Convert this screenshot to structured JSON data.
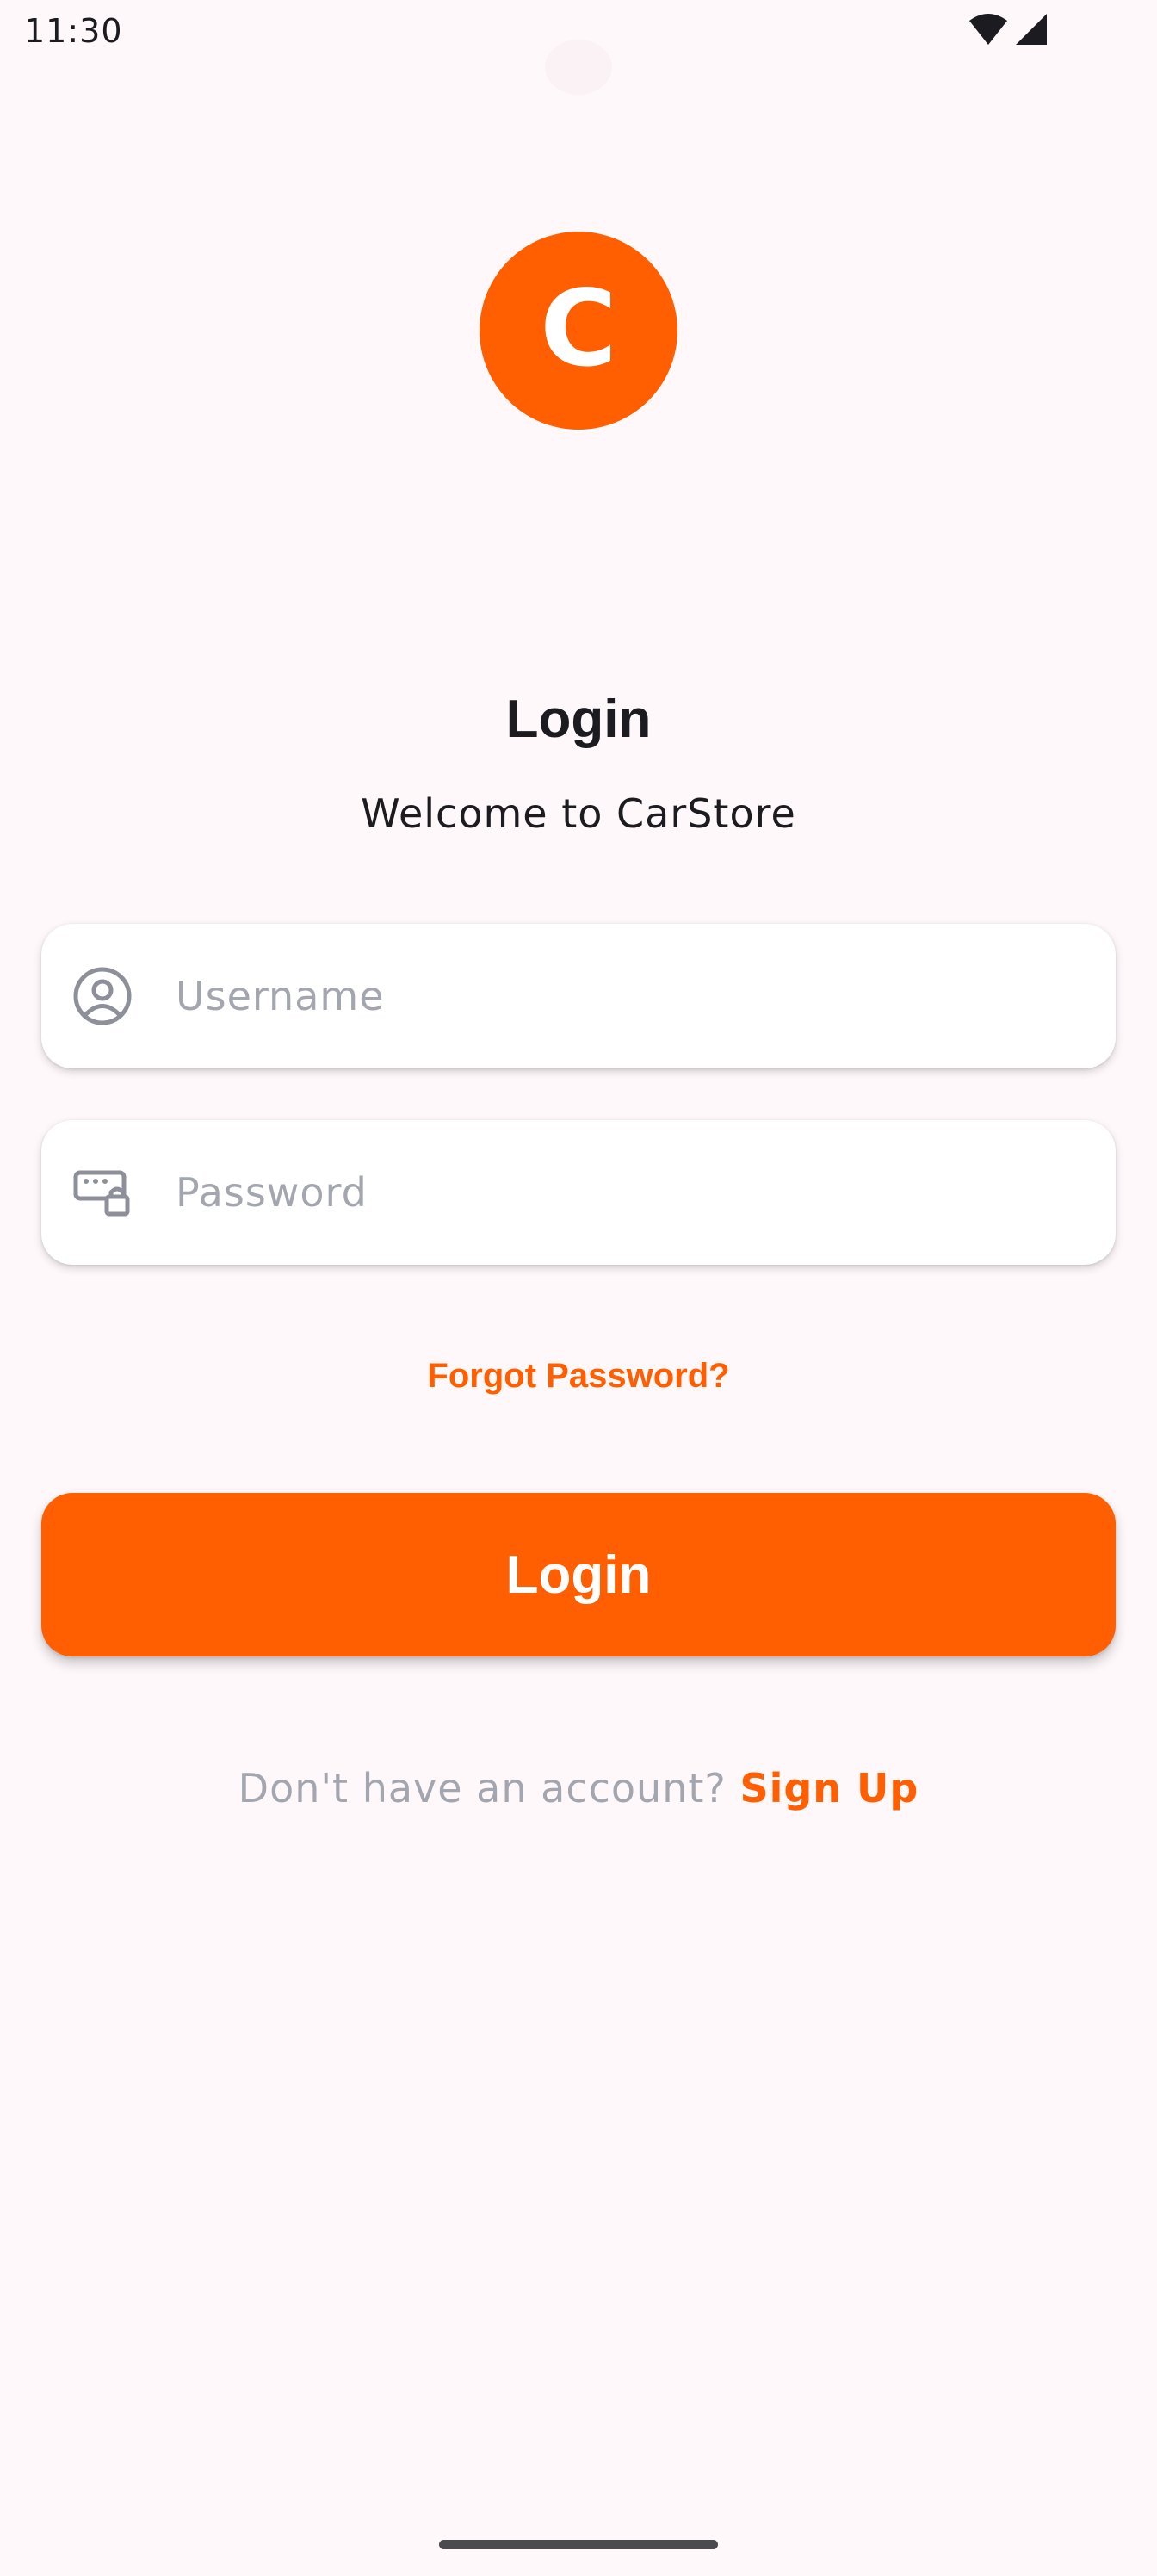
{
  "status_bar": {
    "time": "11:30",
    "wifi_icon": "wifi-icon",
    "signal_icon": "cellular-signal-icon"
  },
  "logo": {
    "letter": "C",
    "color": "#FF5F00"
  },
  "header": {
    "title": "Login",
    "subtitle": "Welcome to CarStore"
  },
  "form": {
    "username": {
      "icon": "user-circle-icon",
      "placeholder": "Username",
      "value": ""
    },
    "password": {
      "icon": "password-lock-icon",
      "placeholder": "Password",
      "value": ""
    },
    "forgot_password_label": "Forgot Password?",
    "login_button_label": "Login"
  },
  "footer": {
    "prompt": "Don't have an account? ",
    "sign_up_label": "Sign Up"
  },
  "colors": {
    "accent": "#FF5F00",
    "background": "#FEF8FB",
    "placeholder": "#A3A6AE",
    "text": "#1C1B1F"
  }
}
